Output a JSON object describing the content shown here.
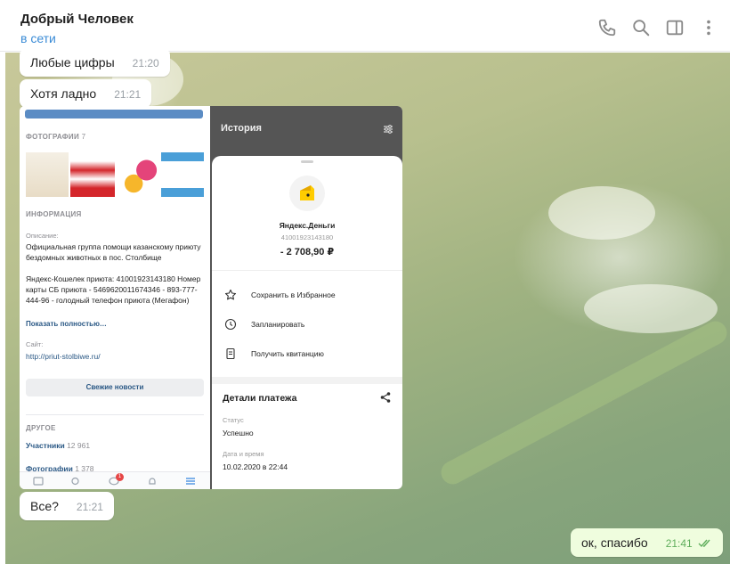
{
  "header": {
    "title": "Добрый Человек",
    "status": "в сети"
  },
  "messages": [
    {
      "text": "Любые цифры",
      "time": "21:20",
      "direction": "in"
    },
    {
      "text": "Хотя ладно",
      "time": "21:21",
      "direction": "in"
    },
    {
      "text": "Все?",
      "time": "21:21",
      "direction": "in"
    },
    {
      "text": "ок, спасибо",
      "time": "21:41",
      "direction": "out",
      "read": true
    }
  ],
  "screenshot_left": {
    "photos_label": "ФОТОГРАФИИ",
    "photos_count": "7",
    "info_label": "ИНФОРМАЦИЯ",
    "desc_label": "Описание:",
    "desc_text": "Официальная группа помощи казанскому приюту бездомных животных в пос. Столбище",
    "details_text": "Яндекс-Кошелек приюта: 41001923143180 Номер карты СБ приюта - 5469620011674346 - 893-777-444-96 - голодный телефон приюта (Мегафон)",
    "show_more": "Показать полностью…",
    "site_label": "Сайт:",
    "site_url": "http://priut-stolbiwe.ru/",
    "news_button": "Свежие новости",
    "other_label": "ДРУГОЕ",
    "members_label": "Участники",
    "members_count": "12 961",
    "photos_link": "Фотографии",
    "photos_link_count": "1 378",
    "notif_badge": "1"
  },
  "screenshot_right": {
    "title": "История",
    "payee": "Яндекс.Деньги",
    "account": "41001923143180",
    "amount": "- 2 708,90 ₽",
    "actions": [
      {
        "label": "Сохранить в Избранное",
        "icon": "star-icon"
      },
      {
        "label": "Запланировать",
        "icon": "clock-icon"
      },
      {
        "label": "Получить квитанцию",
        "icon": "receipt-icon"
      }
    ],
    "details_title": "Детали платежа",
    "status_label": "Статус",
    "status_value": "Успешно",
    "datetime_label": "Дата и время",
    "datetime_value": "10.02.2020 в 22:44"
  },
  "colors": {
    "accent": "#3a8bd6",
    "outgoing_bubble": "#effdde",
    "read_ticks": "#5fae5c",
    "vk_link": "#2a5885",
    "yandex_yellow": "#ffcc00"
  }
}
